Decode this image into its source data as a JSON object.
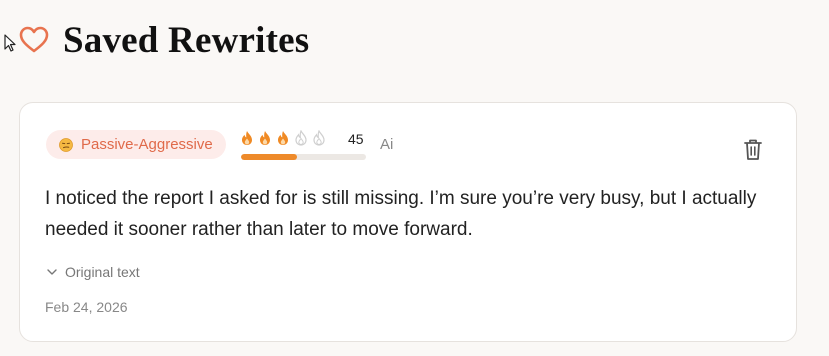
{
  "header": {
    "title": "Saved Rewrites",
    "icon": "heart-icon"
  },
  "colors": {
    "accent": "#e8734f",
    "flame_active": "#f08a24",
    "flame_inactive": "#cfcfcf",
    "badge_bg": "#fdecea",
    "badge_text": "#e06a4a"
  },
  "card": {
    "tone": {
      "label": "Passive-Aggressive",
      "icon": "smirk-emoji-icon"
    },
    "heat": {
      "active_flames": 3,
      "total_flames": 5,
      "value": "45",
      "level_fraction": 0.45
    },
    "ai_label": "Ai",
    "rewrite_text": "I noticed the report I asked for is still missing. I’m sure you’re very busy, but I actually needed it sooner rather than later to move forward.",
    "original_toggle_label": "Original text",
    "date": "Feb 24, 2026",
    "delete_icon": "trash-icon"
  }
}
